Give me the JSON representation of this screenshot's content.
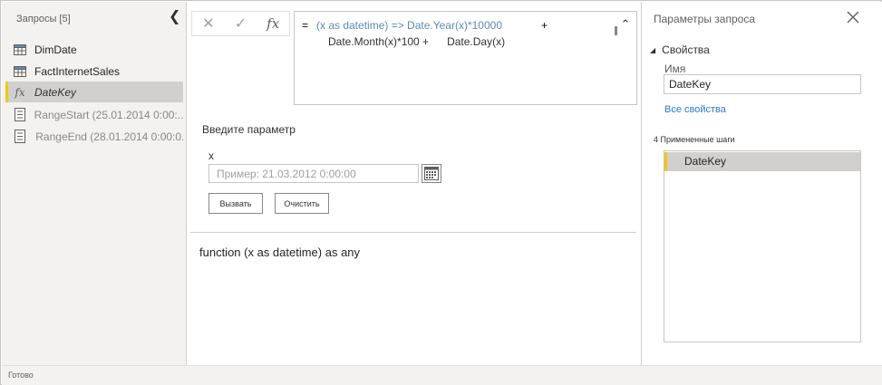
{
  "queries_pane": {
    "header": "Запросы [5]",
    "items": [
      {
        "label": "DimDate",
        "icon": "table-icon",
        "kind": "table"
      },
      {
        "label": "FactInternetSales",
        "icon": "table-icon",
        "kind": "table"
      },
      {
        "label": "DateKey",
        "icon": "function-icon",
        "kind": "function",
        "selected": true
      },
      {
        "label": "RangeStart (25.01.2014 0:00:...",
        "icon": "parameter-icon",
        "kind": "parameter"
      },
      {
        "label": "RangeEnd (28.01.2014 0:00:0...",
        "icon": "parameter-icon",
        "kind": "parameter"
      }
    ]
  },
  "formula_bar": {
    "cancel_glyph": "✕",
    "commit_glyph": "✓",
    "fx_glyph": "fx",
    "eq": "=",
    "line1": "(x as datetime) => Date.Year(x)*10000",
    "line1_tail": "+",
    "line2": "Date.Month(x)*100 +      Date.Day(x)"
  },
  "invoke_panel": {
    "title": "Введите параметр",
    "param_name": "x",
    "placeholder": "Пример: 21.03.2012 0:00:00",
    "invoke_label": "Вызвать",
    "clear_label": "Очистить",
    "signature": "function (x as datetime) as any"
  },
  "settings_pane": {
    "title": "Параметры запроса",
    "properties_label": "Свойства",
    "name_label": "Имя",
    "name_value": "DateKey",
    "all_properties_link": "Все свойства",
    "applied_steps_label": "4 Примененные шаги",
    "steps": [
      "DateKey"
    ]
  },
  "status_bar": {
    "text": "Готово"
  },
  "colors": {
    "selection_accent": "#f2c811",
    "selection_bg": "#d2d0ce",
    "link": "#2b7cd3",
    "formula_blue": "#5b8db8"
  }
}
